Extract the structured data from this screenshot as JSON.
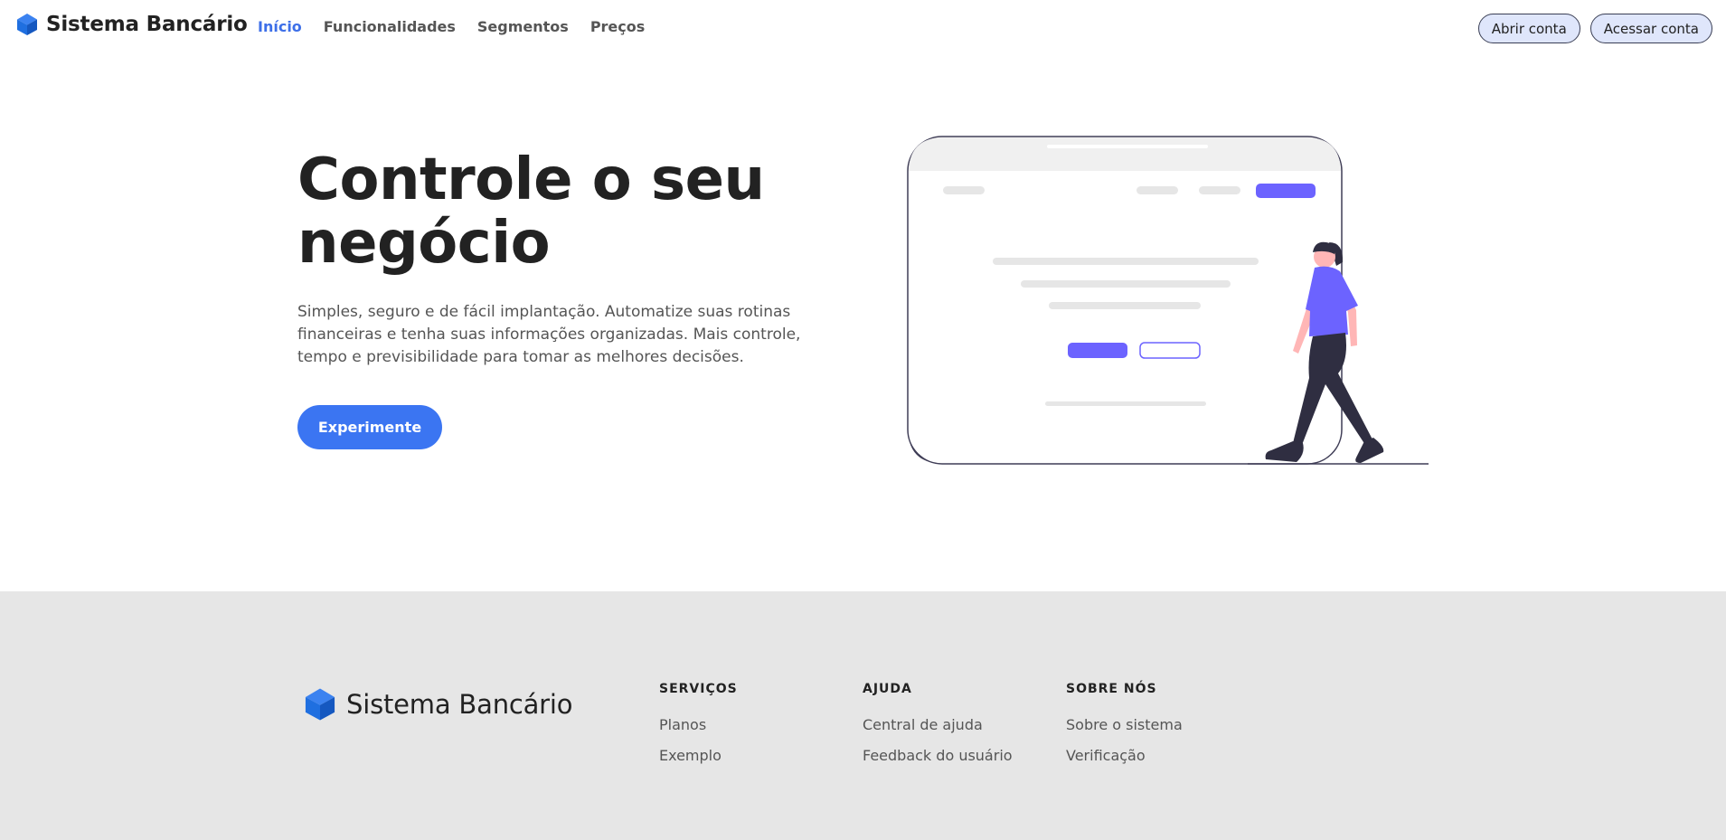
{
  "brand": {
    "name": "Sistema Bancário",
    "icon": "cube-icon",
    "color": "#1f6fe0"
  },
  "nav": {
    "items": [
      {
        "label": "Início",
        "active": true
      },
      {
        "label": "Funcionalidades",
        "active": false
      },
      {
        "label": "Segmentos",
        "active": false
      },
      {
        "label": "Preços",
        "active": false
      }
    ]
  },
  "header_actions": {
    "open_account": "Abrir conta",
    "access_account": "Acessar conta"
  },
  "hero": {
    "title_line1": "Controle o seu",
    "title_line2": "negócio",
    "description": "Simples, seguro e de fácil implantação. Automatize suas rotinas financeiras e tenha suas informações organizadas. Mais controle, tempo e previsibilidade para tomar as melhores decisões.",
    "cta": "Experimente"
  },
  "footer": {
    "brand_name": "Sistema Bancário",
    "columns": [
      {
        "heading": "SERVIÇOS",
        "links": [
          "Planos",
          "Exemplo"
        ]
      },
      {
        "heading": "AJUDA",
        "links": [
          "Central de ajuda",
          "Feedback do usuário"
        ]
      },
      {
        "heading": "SOBRE NÓS",
        "links": [
          "Sobre o sistema",
          "Verificação"
        ]
      }
    ]
  },
  "colors": {
    "accent": "#3b75f2",
    "nav_active": "#3d6fe8",
    "illustration_purple": "#6c63ff",
    "footer_bg": "#e6e6e6"
  }
}
